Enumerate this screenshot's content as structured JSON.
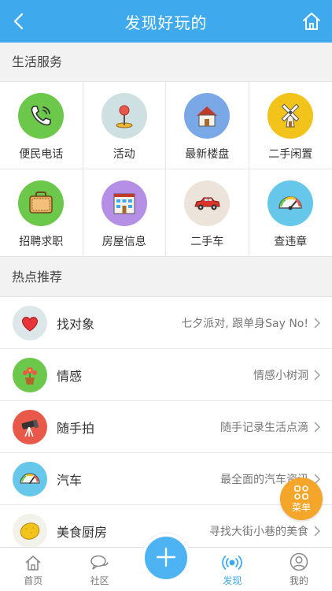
{
  "header": {
    "title": "发现好玩的",
    "back_icon": "back-arrow-icon",
    "home_icon": "home-icon"
  },
  "life_services": {
    "title": "生活服务",
    "items": [
      {
        "label": "便民电话",
        "icon": "phone-icon",
        "color": "#6bc84a"
      },
      {
        "label": "活动",
        "icon": "pin-icon",
        "color": "#cfe0e3"
      },
      {
        "label": "最新楼盘",
        "icon": "house-icon",
        "color": "#7aa8e6"
      },
      {
        "label": "二手闲置",
        "icon": "windmill-icon",
        "color": "#f2c31a"
      },
      {
        "label": "招聘求职",
        "icon": "briefcase-icon",
        "color": "#6bc84a"
      },
      {
        "label": "房屋信息",
        "icon": "building-icon",
        "color": "#b58ee6"
      },
      {
        "label": "二手车",
        "icon": "car-icon",
        "color": "#ece4da"
      },
      {
        "label": "查违章",
        "icon": "speedometer-icon",
        "color": "#66c7ea"
      }
    ]
  },
  "hot": {
    "title": "热点推荐",
    "items": [
      {
        "title": "找对象",
        "desc": "七夕派对, 跟单身Say No!",
        "icon": "heart-icon",
        "color": "#dde7ea"
      },
      {
        "title": "情感",
        "desc": "情感小树洞",
        "icon": "flower-pot-icon",
        "color": "#6bc84a"
      },
      {
        "title": "随手拍",
        "desc": "随手记录生活点滴",
        "icon": "telescope-icon",
        "color": "#e8594a"
      },
      {
        "title": "汽车",
        "desc": "最全面的汽车资讯",
        "icon": "gauge-icon",
        "color": "#66c7ea"
      },
      {
        "title": "美食厨房",
        "desc": "寻找大街小巷的美食",
        "icon": "lemon-icon",
        "color": "#f2f2ea"
      }
    ]
  },
  "float_menu": {
    "label": "菜单"
  },
  "tabbar": {
    "items": [
      {
        "label": "首页",
        "icon": "home-tab-icon"
      },
      {
        "label": "社区",
        "icon": "chat-icon"
      },
      {
        "label": "",
        "icon": "plus-icon"
      },
      {
        "label": "发现",
        "icon": "broadcast-icon",
        "active": true
      },
      {
        "label": "我的",
        "icon": "user-icon"
      }
    ]
  },
  "colors": {
    "primary": "#3fa9ee",
    "accent": "#f4a62a"
  }
}
